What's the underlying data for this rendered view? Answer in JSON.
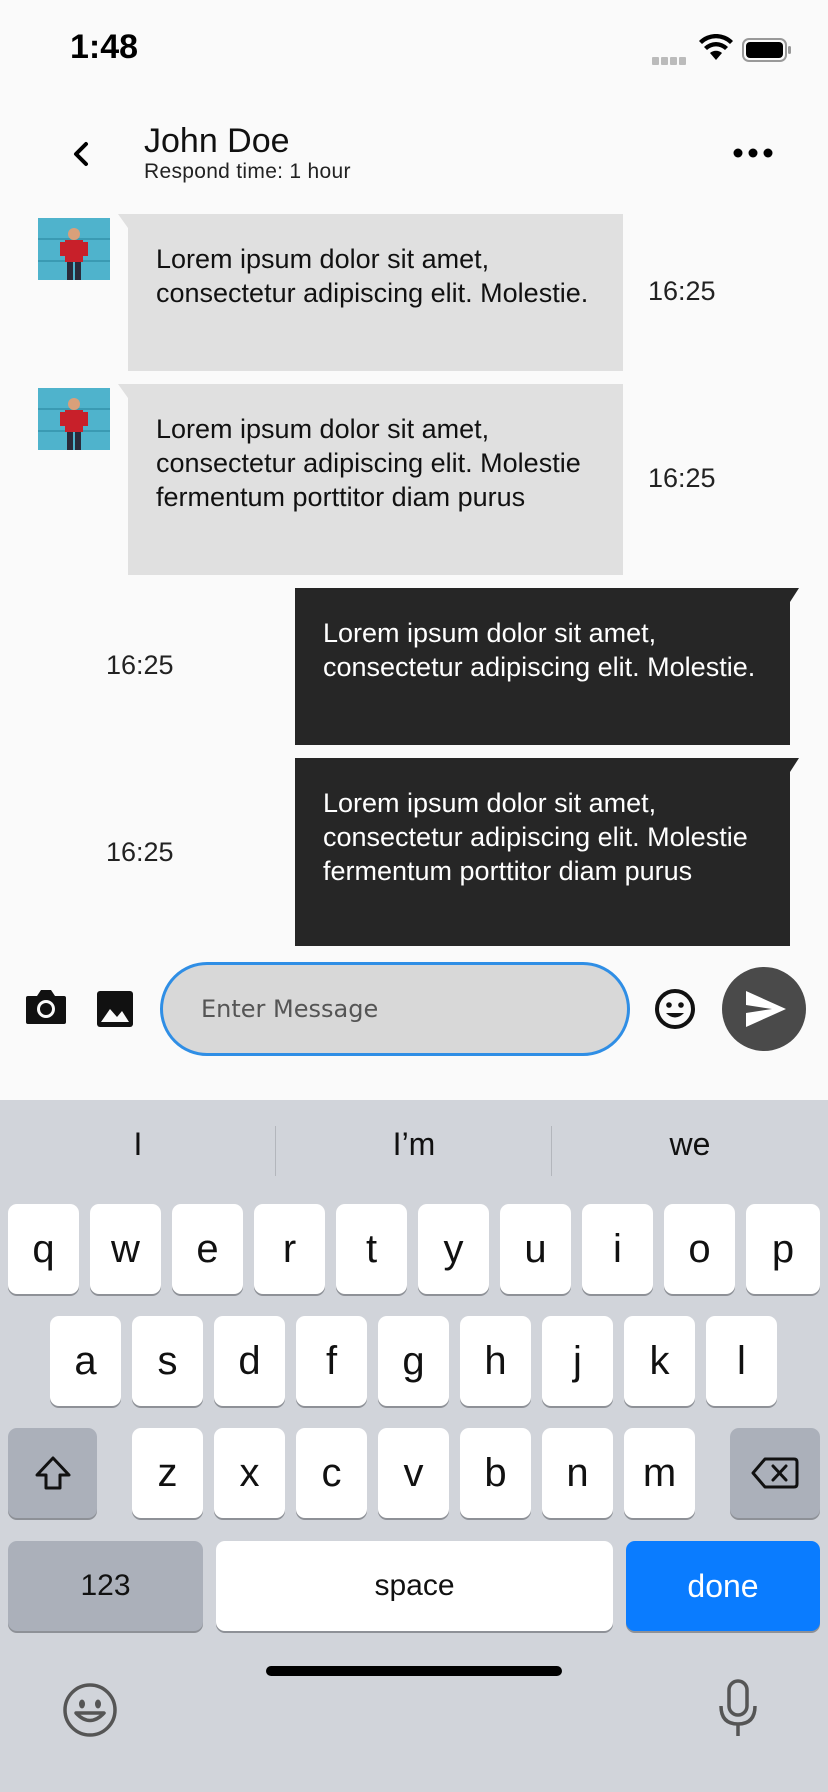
{
  "status_bar": {
    "time": "1:48"
  },
  "header": {
    "name": "John Doe",
    "respond_time": "Respond time: 1 hour"
  },
  "messages": [
    {
      "direction": "incoming",
      "text": "Lorem ipsum dolor sit amet, consectetur adipiscing elit. Molestie.",
      "time": "16:25"
    },
    {
      "direction": "incoming",
      "text": "Lorem ipsum dolor sit amet, consectetur adipiscing elit. Molestie fermentum porttitor diam purus",
      "time": "16:25"
    },
    {
      "direction": "outgoing",
      "text": "Lorem ipsum dolor sit amet, consectetur adipiscing elit. Molestie.",
      "time": "16:25"
    },
    {
      "direction": "outgoing",
      "text": "Lorem ipsum dolor sit amet, consectetur adipiscing elit. Molestie fermentum porttitor diam purus",
      "time": "16:25"
    }
  ],
  "composer": {
    "placeholder": "Enter Message",
    "input_border_color": "#2f8ee5"
  },
  "keyboard": {
    "suggestions": [
      "I",
      "I’m",
      "we"
    ],
    "row1": [
      "q",
      "w",
      "e",
      "r",
      "t",
      "y",
      "u",
      "i",
      "o",
      "p"
    ],
    "row2": [
      "a",
      "s",
      "d",
      "f",
      "g",
      "h",
      "j",
      "k",
      "l"
    ],
    "row3": [
      "z",
      "x",
      "c",
      "v",
      "b",
      "n",
      "m"
    ],
    "numbers_label": "123",
    "space_label": "space",
    "done_label": "done",
    "done_color": "#0a7cff"
  },
  "icons": {
    "back": "chevron-left-icon",
    "more": "more-horizontal-icon",
    "camera": "camera-icon",
    "gallery": "image-icon",
    "emoji": "emoji-icon",
    "send": "send-icon",
    "shift": "shift-icon",
    "backspace": "backspace-icon",
    "keyboard_emoji": "keyboard-emoji-icon",
    "microphone": "microphone-icon"
  }
}
